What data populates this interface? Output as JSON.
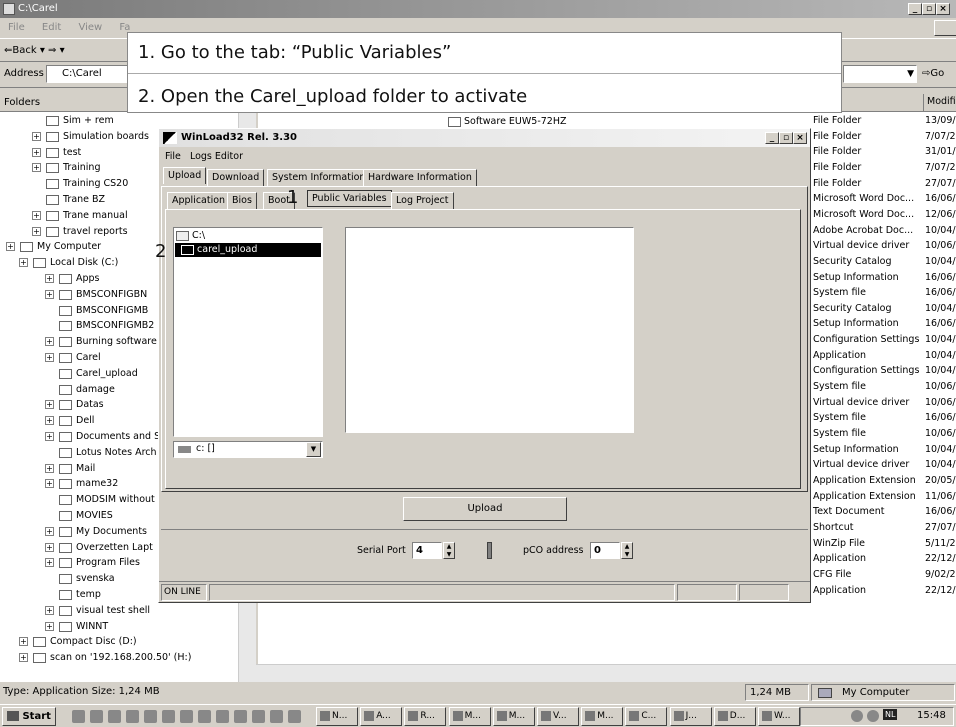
{
  "window": {
    "title": "C:\\Carel"
  },
  "menu": [
    "File",
    "Edit",
    "View",
    "Fa"
  ],
  "toolbar": {
    "back": "⇐Back ▾ ⇒ ▾"
  },
  "address": {
    "label": "Address",
    "value": "C:\\Carel",
    "go": "Go"
  },
  "folders_label": "Folders",
  "modified_label": "Modifie",
  "tree": [
    {
      "label": "Sim + rem",
      "depth": 3,
      "exp": false
    },
    {
      "label": "Simulation boards",
      "depth": 3,
      "exp": true
    },
    {
      "label": "test",
      "depth": 3,
      "exp": true
    },
    {
      "label": "Training",
      "depth": 3,
      "exp": true
    },
    {
      "label": "Training CS20",
      "depth": 3,
      "exp": false
    },
    {
      "label": "Trane BZ",
      "depth": 3,
      "exp": false
    },
    {
      "label": "Trane manual",
      "depth": 3,
      "exp": true
    },
    {
      "label": "travel reports",
      "depth": 3,
      "exp": true
    },
    {
      "label": "My Computer",
      "depth": 1,
      "exp": true
    },
    {
      "label": "Local Disk (C:)",
      "depth": 2,
      "exp": true
    },
    {
      "label": "Apps",
      "depth": 4,
      "exp": true
    },
    {
      "label": "BMSCONFIGBN",
      "depth": 4,
      "exp": true
    },
    {
      "label": "BMSCONFIGMB",
      "depth": 4,
      "exp": false
    },
    {
      "label": "BMSCONFIGMB2",
      "depth": 4,
      "exp": false
    },
    {
      "label": "Burning software",
      "depth": 4,
      "exp": true
    },
    {
      "label": "Carel",
      "depth": 4,
      "exp": true
    },
    {
      "label": "Carel_upload",
      "depth": 4,
      "exp": false
    },
    {
      "label": "damage",
      "depth": 4,
      "exp": false
    },
    {
      "label": "Datas",
      "depth": 4,
      "exp": true
    },
    {
      "label": "Dell",
      "depth": 4,
      "exp": true
    },
    {
      "label": "Documents and S",
      "depth": 4,
      "exp": true
    },
    {
      "label": "Lotus Notes Arch",
      "depth": 4,
      "exp": false
    },
    {
      "label": "Mail",
      "depth": 4,
      "exp": true
    },
    {
      "label": "mame32",
      "depth": 4,
      "exp": true
    },
    {
      "label": "MODSIM without",
      "depth": 4,
      "exp": false
    },
    {
      "label": "MOVIES",
      "depth": 4,
      "exp": false
    },
    {
      "label": "My Documents",
      "depth": 4,
      "exp": true
    },
    {
      "label": "Overzetten Lapt",
      "depth": 4,
      "exp": true
    },
    {
      "label": "Program Files",
      "depth": 4,
      "exp": true
    },
    {
      "label": "svenska",
      "depth": 4,
      "exp": false
    },
    {
      "label": "temp",
      "depth": 4,
      "exp": false
    },
    {
      "label": "visual test shell",
      "depth": 4,
      "exp": true
    },
    {
      "label": "WINNT",
      "depth": 4,
      "exp": true
    },
    {
      "label": "Compact Disc (D:)",
      "depth": 2,
      "exp": true
    },
    {
      "label": "scan on '192.168.200.50' (H:)",
      "depth": 2,
      "exp": true
    }
  ],
  "file_row_top": "Software EUW5-72HZ",
  "files": [
    {
      "type": "File Folder",
      "date": "13/09/"
    },
    {
      "type": "File Folder",
      "date": "7/07/2"
    },
    {
      "type": "File Folder",
      "date": "31/01/"
    },
    {
      "type": "File Folder",
      "date": "7/07/2"
    },
    {
      "type": "File Folder",
      "date": "27/07/"
    },
    {
      "type": "Microsoft Word Doc...",
      "date": "16/06/"
    },
    {
      "type": "Microsoft Word Doc...",
      "date": "12/06/"
    },
    {
      "type": "Adobe Acrobat Doc...",
      "date": "10/04/"
    },
    {
      "type": "Virtual device driver",
      "date": "10/06/"
    },
    {
      "type": "Security Catalog",
      "date": "10/04/"
    },
    {
      "type": "Setup Information",
      "date": "16/06/"
    },
    {
      "type": "System file",
      "date": "16/06/"
    },
    {
      "type": "Security Catalog",
      "date": "10/04/"
    },
    {
      "type": "Setup Information",
      "date": "16/06/"
    },
    {
      "type": "Configuration Settings",
      "date": "10/04/"
    },
    {
      "type": "Application",
      "date": "10/04/"
    },
    {
      "type": "Configuration Settings",
      "date": "10/04/"
    },
    {
      "type": "System file",
      "date": "10/06/"
    },
    {
      "type": "Virtual device driver",
      "date": "10/06/"
    },
    {
      "type": "System file",
      "date": "16/06/"
    },
    {
      "type": "System file",
      "date": "10/06/"
    },
    {
      "type": "Setup Information",
      "date": "10/04/"
    },
    {
      "type": "Virtual device driver",
      "date": "10/04/"
    },
    {
      "type": "Application Extension",
      "date": "20/05/"
    },
    {
      "type": "Application Extension",
      "date": "11/06/"
    },
    {
      "type": "Text Document",
      "date": "16/06/"
    },
    {
      "type": "Shortcut",
      "date": "27/07/"
    },
    {
      "type": "WinZip File",
      "date": "5/11/2"
    },
    {
      "type": "Application",
      "date": "22/12/"
    },
    {
      "type": "CFG File",
      "date": "9/02/2"
    },
    {
      "type": "Application",
      "date": "22/12/"
    }
  ],
  "callout": {
    "step1": "1.  Go to the tab: “Public Variables”",
    "step2": "2.  Open the Carel_upload folder to activate"
  },
  "dialog": {
    "title": "WinLoad32  Rel. 3.30",
    "menu": [
      "File",
      "Logs Editor"
    ],
    "tabs_top": [
      "Upload",
      "Download",
      "System Information",
      "Hardware Information"
    ],
    "tabs_sub": [
      "Application",
      "Bios",
      "Boot",
      "Public Variables",
      "Log Project"
    ],
    "tree_root": "C:\\",
    "tree_selected": "carel_upload",
    "drive": "c: []",
    "upload_btn": "Upload",
    "serial_label": "Serial Port",
    "serial_value": "4",
    "pco_label": "pCO address",
    "pco_value": "0",
    "status": "ON LINE",
    "marker1": "1",
    "marker2": "2"
  },
  "statusbar": {
    "left": "Type: Application Size: 1,24 MB",
    "size": "1,24 MB",
    "location": "My Computer"
  },
  "taskbar": {
    "start": "Start",
    "items": [
      "N...",
      "A...",
      "R...",
      "M...",
      "M...",
      "V...",
      "M...",
      "C...",
      "J...",
      "D...",
      "W..."
    ],
    "lang": "NL",
    "clock": "15:48"
  }
}
